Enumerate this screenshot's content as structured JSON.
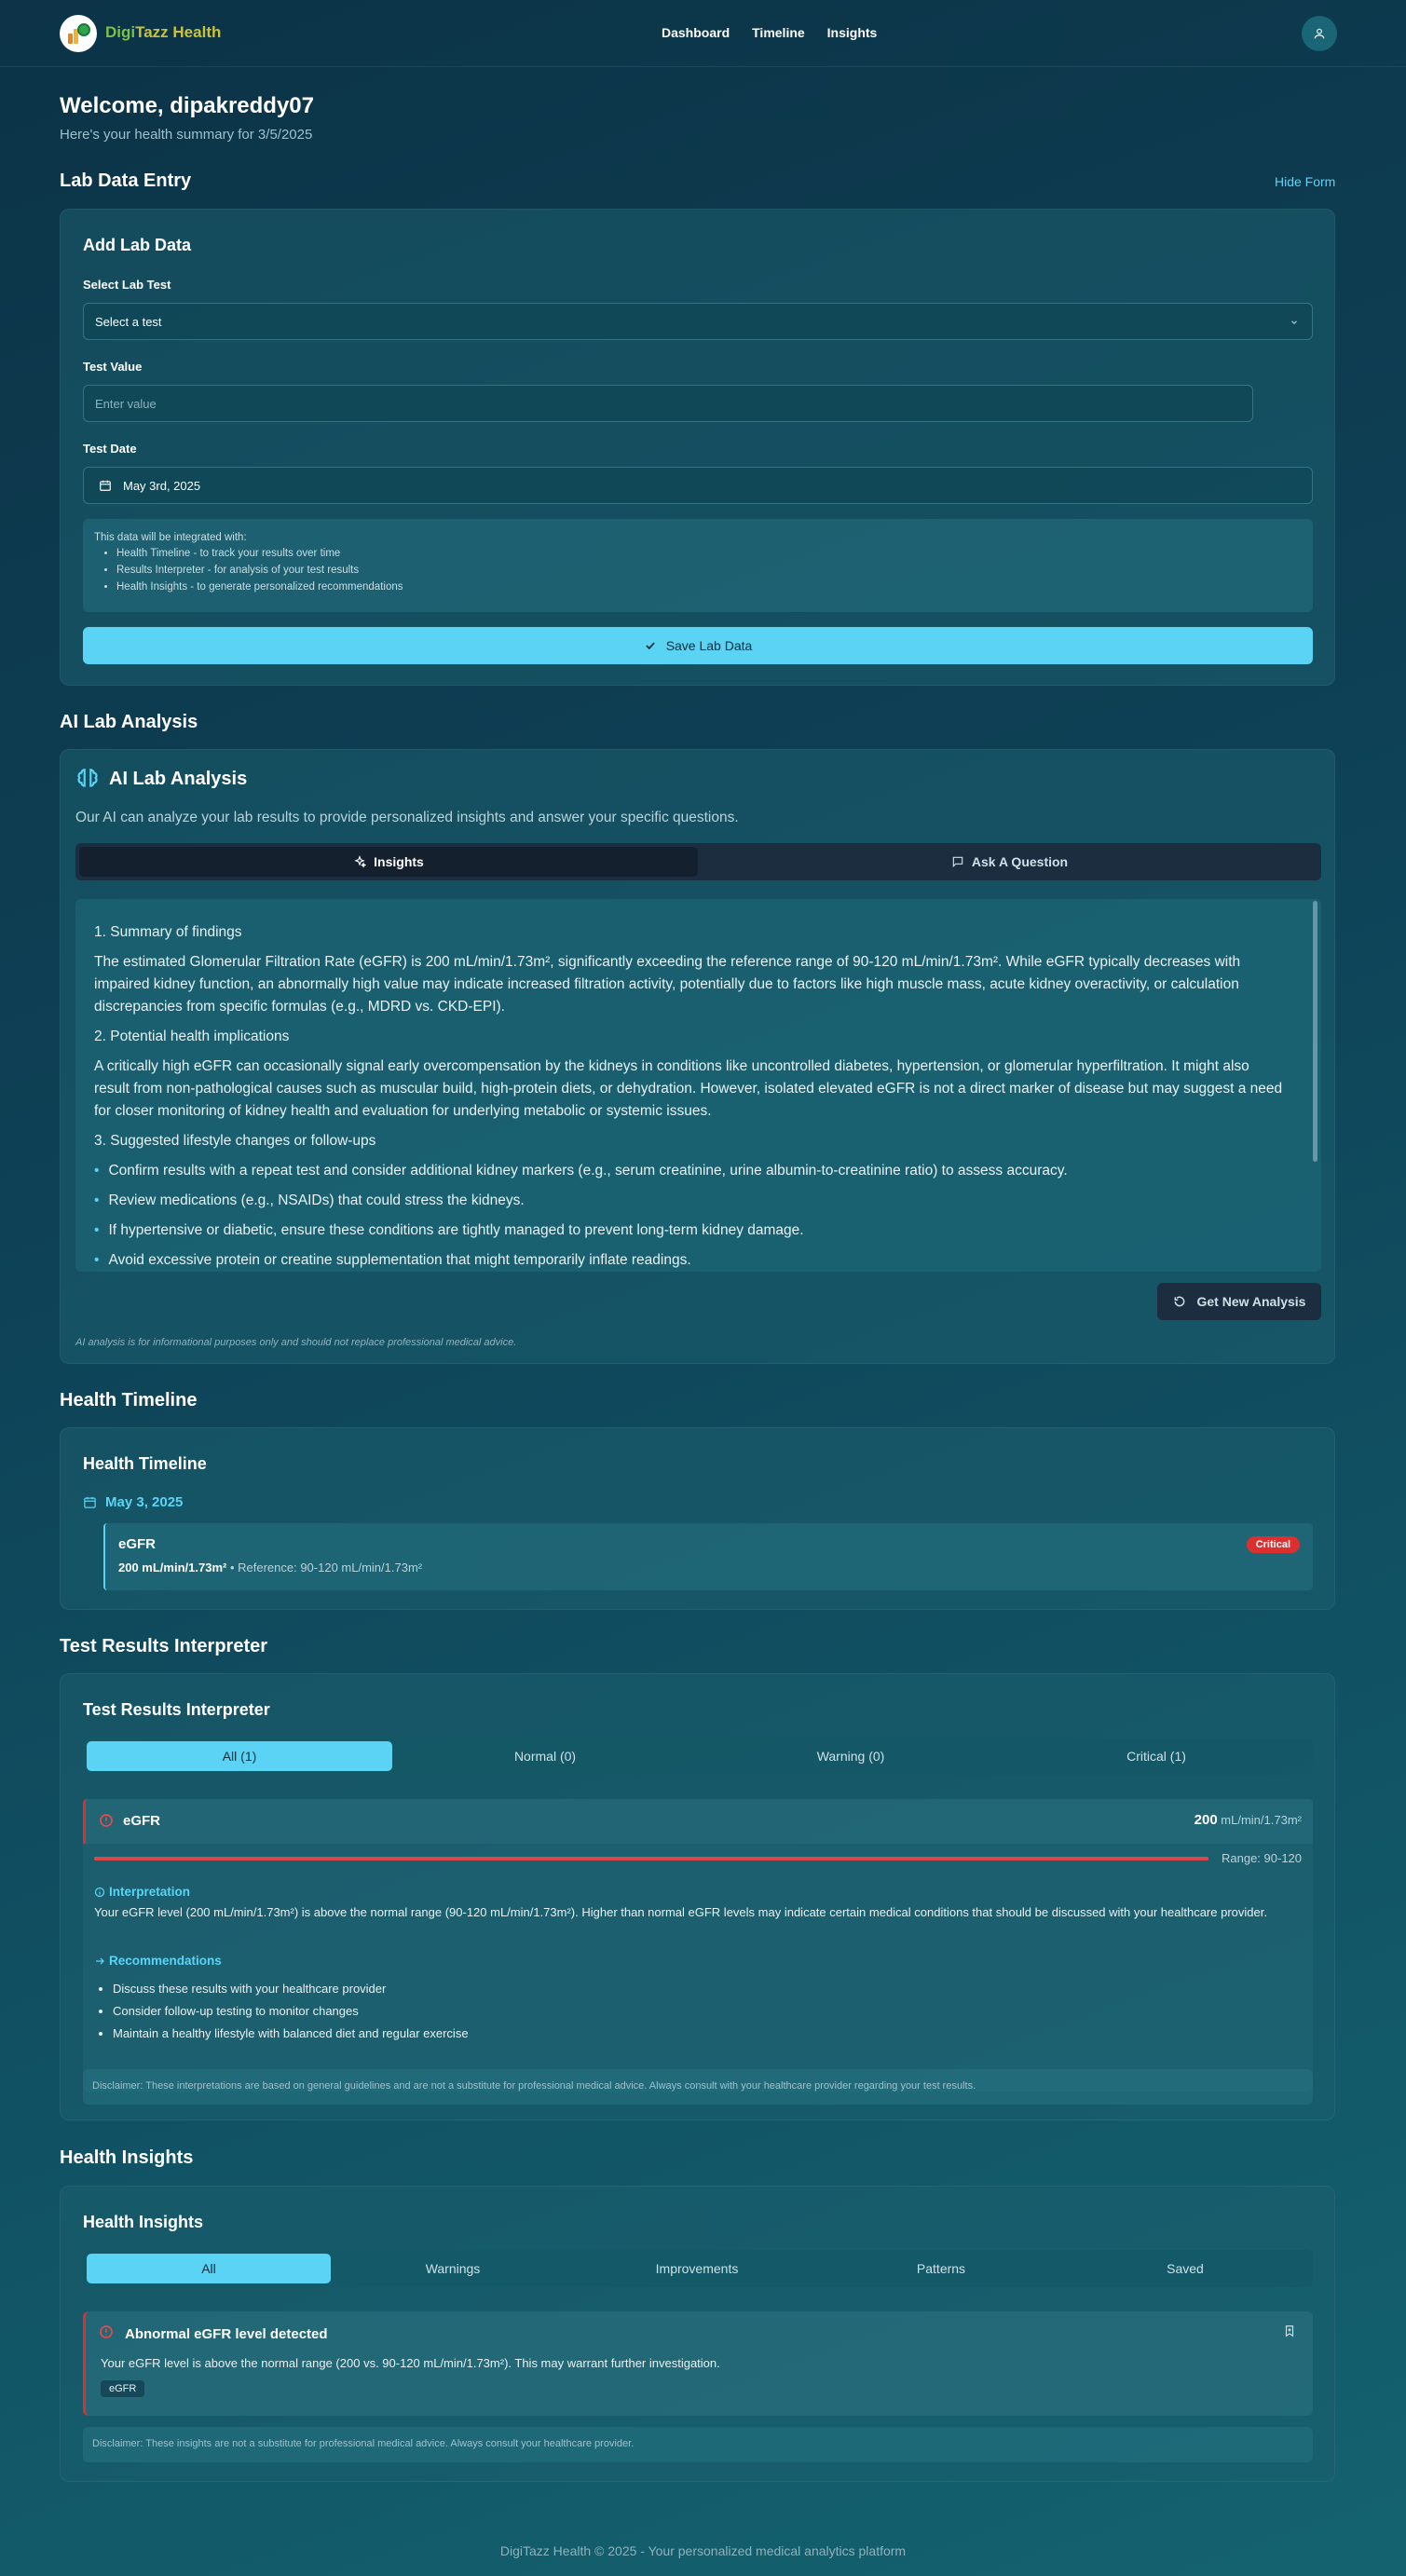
{
  "nav": {
    "brand_prefix": "Digi",
    "brand_suffix": "Tazz Health",
    "links": [
      "Dashboard",
      "Timeline",
      "Insights"
    ]
  },
  "welcome": {
    "title": "Welcome, dipakreddy07",
    "subtitle": "Here's your health summary for 3/5/2025"
  },
  "lab_entry": {
    "section_title": "Lab Data Entry",
    "hide_form": "Hide Form",
    "card_title": "Add Lab Data",
    "select_label": "Select Lab Test",
    "select_value": "Select a test",
    "value_label": "Test Value",
    "value_placeholder": "Enter value",
    "date_label": "Test Date",
    "date_value": "May 3rd, 2025",
    "info_heading": "This data will be integrated with:",
    "info_items": [
      "Health Timeline - to track your results over time",
      "Results Interpreter - for analysis of your test results",
      "Health Insights - to generate personalized recommendations"
    ],
    "save_button": "Save Lab Data"
  },
  "ai_analysis": {
    "section_title": "AI Lab Analysis",
    "card_title": "AI Lab Analysis",
    "description": "Our AI can analyze your lab results to provide personalized insights and answer your specific questions.",
    "tabs": [
      "Insights",
      "Ask A Question"
    ],
    "content": {
      "h1": "1. Summary of findings",
      "p1": "The estimated Glomerular Filtration Rate (eGFR) is 200 mL/min/1.73m², significantly exceeding the reference range of 90-120 mL/min/1.73m². While eGFR typically decreases with impaired kidney function, an abnormally high value may indicate increased filtration activity, potentially due to factors like high muscle mass, acute kidney overactivity, or calculation discrepancies from specific formulas (e.g., MDRD vs. CKD-EPI).",
      "h2": "2. Potential health implications",
      "p2": "A critically high eGFR can occasionally signal early overcompensation by the kidneys in conditions like uncontrolled diabetes, hypertension, or glomerular hyperfiltration. It might also result from non-pathological causes such as muscular build, high-protein diets, or dehydration. However, isolated elevated eGFR is not a direct marker of disease but may suggest a need for closer monitoring of kidney health and evaluation for underlying metabolic or systemic issues.",
      "h3": "3. Suggested lifestyle changes or follow-ups",
      "bullets": [
        "Confirm results with a repeat test and consider additional kidney markers (e.g., serum creatinine, urine albumin-to-creatinine ratio) to assess accuracy.",
        "Review medications (e.g., NSAIDs) that could stress the kidneys.",
        "If hypertensive or diabetic, ensure these conditions are tightly managed to prevent long-term kidney damage.",
        "Avoid excessive protein or creatine supplementation that might temporarily inflate readings."
      ]
    },
    "new_analysis_button": "Get New Analysis",
    "disclaimer": "AI analysis is for informational purposes only and should not replace professional medical advice."
  },
  "timeline": {
    "section_title": "Health Timeline",
    "card_title": "Health Timeline",
    "date": "May 3, 2025",
    "entry": {
      "test": "eGFR",
      "value": "200 mL/min/1.73m²",
      "reference": "• Reference: 90-120 mL/min/1.73m²",
      "badge": "Critical"
    }
  },
  "interpreter": {
    "section_title": "Test Results Interpreter",
    "card_title": "Test Results Interpreter",
    "tabs": [
      "All (1)",
      "Normal (0)",
      "Warning (0)",
      "Critical (1)"
    ],
    "result": {
      "test": "eGFR",
      "value": "200",
      "unit": "mL/min/1.73m²",
      "range": "Range: 90-120",
      "level": 1.0,
      "interpretation_title": "Interpretation",
      "interpretation_text": "Your eGFR level (200 mL/min/1.73m²) is above the normal range (90-120 mL/min/1.73m²). Higher than normal eGFR levels may indicate certain medical conditions that should be discussed with your healthcare provider.",
      "recommendations_title": "Recommendations",
      "recommendations": [
        "Discuss these results with your healthcare provider",
        "Consider follow-up testing to monitor changes",
        "Maintain a healthy lifestyle with balanced diet and regular exercise"
      ]
    },
    "disclaimer": "Disclaimer: These interpretations are based on general guidelines and are not a substitute for professional medical advice. Always consult with your healthcare provider regarding your test results."
  },
  "insights": {
    "section_title": "Health Insights",
    "card_title": "Health Insights",
    "tabs": [
      "All",
      "Warnings",
      "Improvements",
      "Patterns",
      "Saved"
    ],
    "alert": {
      "title": "Abnormal eGFR level detected",
      "text": "Your eGFR level is above the normal range (200 vs. 90-120 mL/min/1.73m²). This may warrant further investigation.",
      "tag": "eGFR"
    },
    "disclaimer": "Disclaimer: These insights are not a substitute for professional medical advice. Always consult your healthcare provider."
  },
  "footer": {
    "text": "DigiTazz Health © 2025 - Your personalized medical analytics platform"
  },
  "colors": {
    "accent": "#5bd3f5",
    "critical": "#dc3030",
    "brand_green": "#7bc04a",
    "brand_yellow": "#c9c23a"
  }
}
